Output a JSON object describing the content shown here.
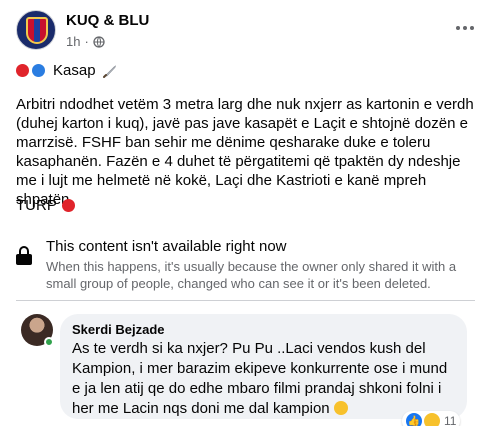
{
  "post": {
    "page_name": "KUQ & BLU",
    "time": "1h",
    "dot_separator": "·",
    "title": "Kasap",
    "body": "Arbitri ndodhet vetëm 3 metra larg dhe nuk nxjerr as kartonin e verdh (duhej karton i kuq), javë pas jave kasapët e Laçit e shtojnë dozën e marrzisë. FSHF ban sehir me dënime qesharake duke e toleru kasaphanën. Fazën e 4 duhet të përgatitemi që tpaktën dy ndeshje me i lujt me helmetë në kokë, Laçi dhe Kastrioti e kanë mpreh shpatën.",
    "closing": "TURP"
  },
  "unavailable": {
    "title": "This content isn't available right now",
    "description": "When this happens, it's usually because the owner only shared it with a small group of people, changed who can see it or it's been deleted."
  },
  "comment": {
    "author": "Skerdi Bejzade",
    "text": "As te verdh si ka nxjer? Pu Pu ..Laci vendos kush del Kampion, i mer barazim ekipeve konkurrente ose i mund e ja len atij qe do edhe mbaro filmi prandaj shkoni folni i her me Lacin nqs doni me dal kampion",
    "reaction_count": "11",
    "reactions": [
      "like",
      "haha"
    ]
  },
  "colors": {
    "club_red": "#e0242b",
    "club_blue": "#2a7de1",
    "secondary_text": "#65676b",
    "comment_bg": "#f0f2f5",
    "like_blue": "#1877f2"
  },
  "icons": [
    "globe-icon",
    "more-options-icon",
    "knife-icon",
    "lock-icon",
    "wink-emoji-icon",
    "like-reaction-icon",
    "haha-reaction-icon"
  ]
}
